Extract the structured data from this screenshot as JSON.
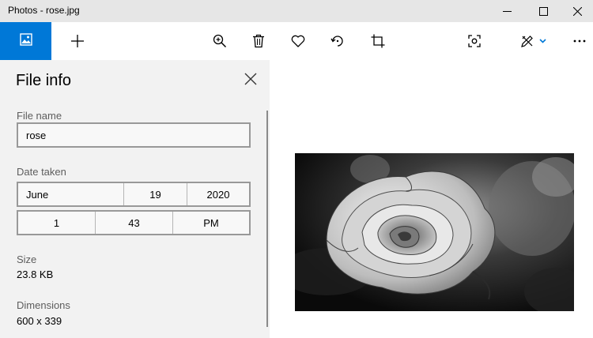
{
  "window": {
    "title": "Photos - rose.jpg",
    "minimize_icon": "minimize-icon",
    "maximize_icon": "maximize-icon",
    "close_icon": "close-icon"
  },
  "toolbar": {
    "thumbnail_icon": "image-thumbnail-icon",
    "accent_color": "#0078d7",
    "buttons": [
      {
        "name": "add-icon"
      },
      {
        "name": "zoom-in-icon"
      },
      {
        "name": "delete-icon"
      },
      {
        "name": "favorite-heart-icon"
      },
      {
        "name": "rotate-icon"
      },
      {
        "name": "crop-icon"
      },
      {
        "name": "enhance-icon"
      },
      {
        "name": "edit-create-icon"
      },
      {
        "name": "more-icon"
      }
    ]
  },
  "file_info": {
    "title": "File info",
    "file_name_label": "File name",
    "file_name_value": "rose",
    "date_taken_label": "Date taken",
    "date": {
      "month": "June",
      "day": "19",
      "year": "2020"
    },
    "time": {
      "hour": "1",
      "minute": "43",
      "period": "PM"
    },
    "size_label": "Size",
    "size_value": "23.8 KB",
    "dimensions_label": "Dimensions",
    "dimensions_value": "600 x 339"
  },
  "image": {
    "description": "black and white rose photo"
  }
}
